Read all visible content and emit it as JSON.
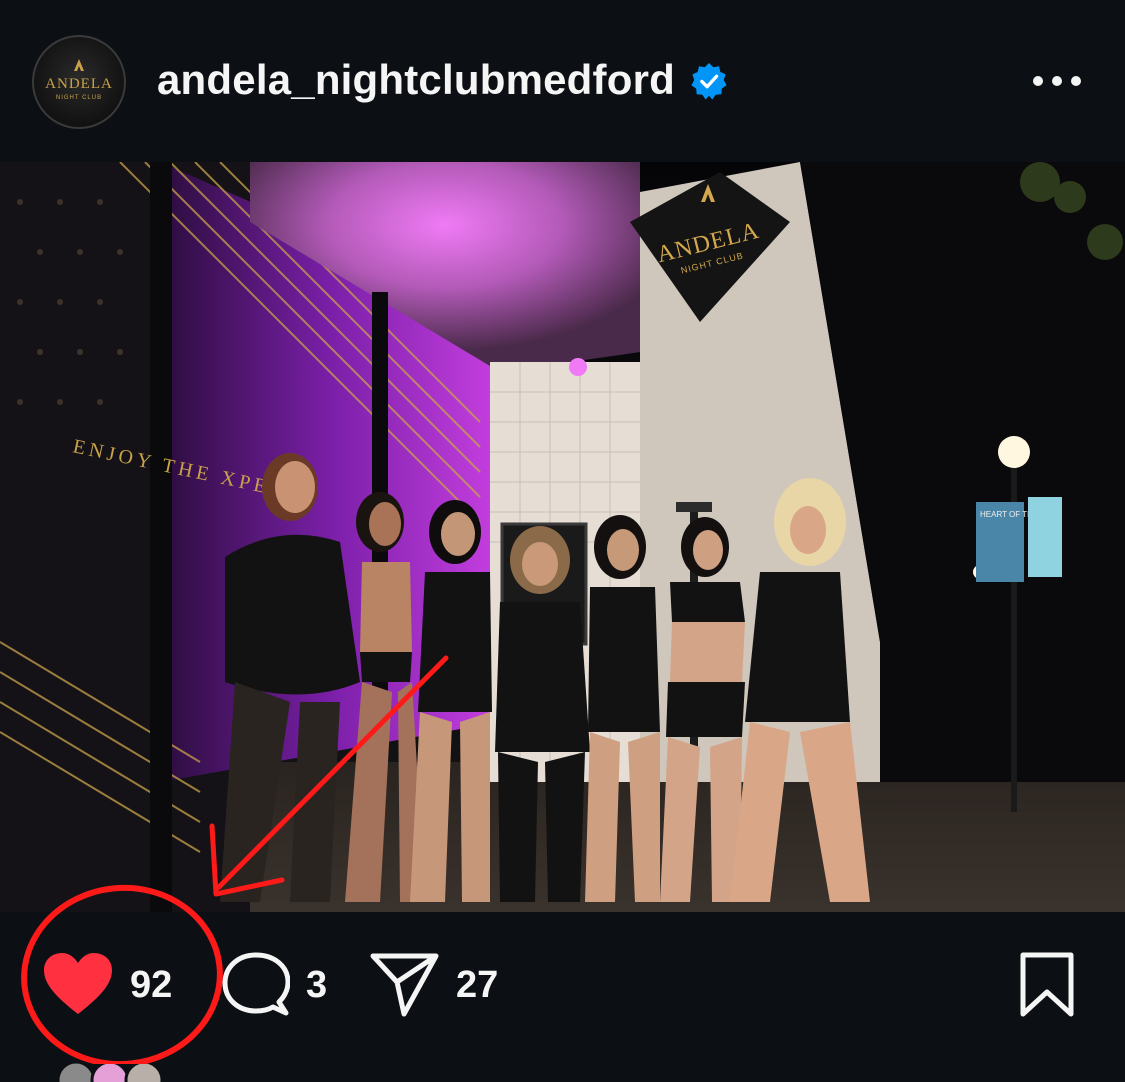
{
  "post": {
    "username": "andela_nightclubmedford",
    "verified": true,
    "avatar_icon": "andela-logo-icon",
    "likes": "92",
    "comments": "3",
    "shares": "27"
  },
  "photo": {
    "sign_text": "ANDELA",
    "sign_subtext": "NIGHT CLUB",
    "wall_text": "ENJOY THE XPERI",
    "banner_text": "HEART OF THE"
  },
  "colors": {
    "background": "#0c1014",
    "text": "#f5f5f5",
    "like_red": "#ff3040",
    "verified_blue": "#0095f6",
    "annotation_red": "#ff1a1a"
  }
}
